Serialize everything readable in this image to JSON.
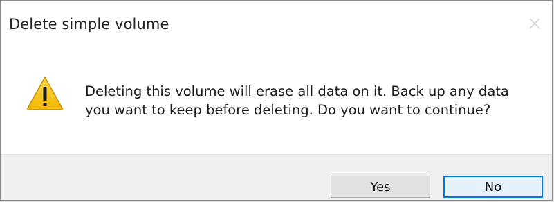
{
  "dialog": {
    "title": "Delete simple volume",
    "close_icon": "close-icon",
    "warning_icon": "warning-icon",
    "message": "Deleting this volume will erase all data on it. Back up any data you want to keep before deleting. Do you want to continue?",
    "message_line_1": "Deleting this volume will erase all data on it. Back up any data",
    "message_line_2": "you want to keep before deleting. Do you want to continue?",
    "buttons": {
      "yes_label": "Yes",
      "no_label": "No"
    },
    "colors": {
      "warning_fill": "#f7c51e",
      "warning_outline": "#c88f00",
      "default_button_border": "#0078d7"
    }
  }
}
